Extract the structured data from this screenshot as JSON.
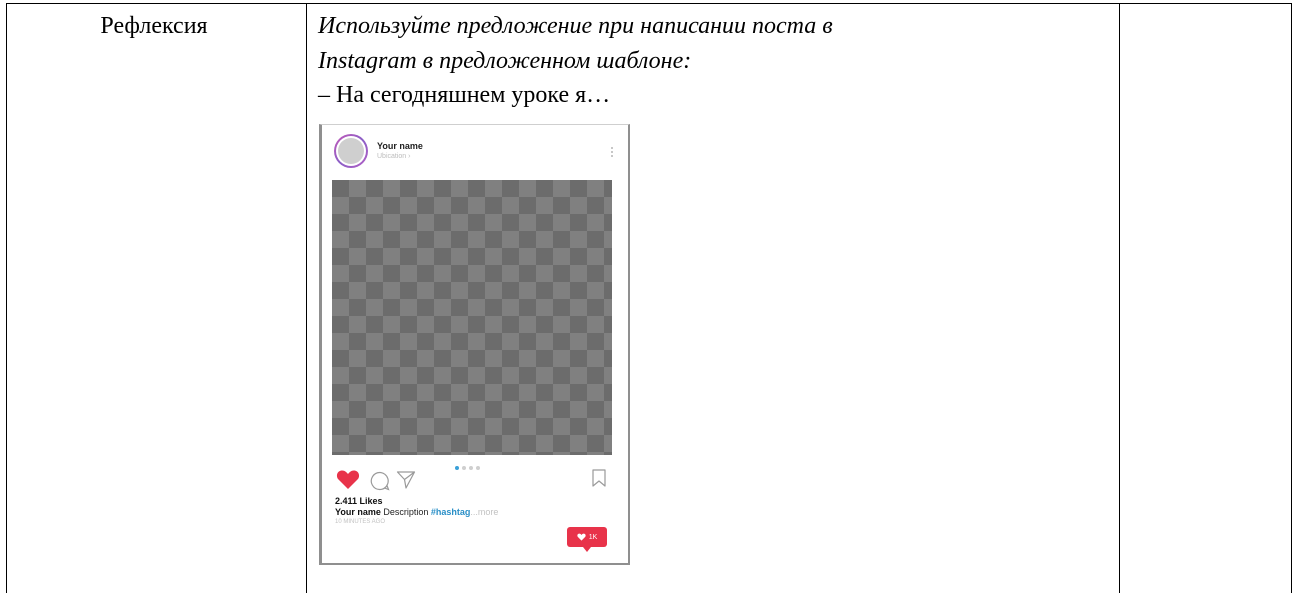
{
  "table": {
    "label_cell": "Рефлексия",
    "instruction_line1": "Используйте предложение при написании поста в",
    "instruction_line2": "Instagram в предложенном шаблоне:",
    "prompt_line": "– На сегодняшнем уроке я…"
  },
  "template": {
    "username": "Your name",
    "location": "Ubication ›",
    "carousel_dots": 4,
    "active_dot": 1,
    "likes": "2.411 Likes",
    "caption_user": "Your name",
    "caption_text": " Description ",
    "caption_hashtag": "#hashtag",
    "caption_more": "...more",
    "timestamp": "10 MINUTES AGO",
    "notification_count": "1K",
    "icons": [
      "heart-icon",
      "comment-icon",
      "share-icon",
      "bookmark-icon",
      "more-options-icon"
    ],
    "colors": {
      "heart": "#e8334a",
      "hashtag": "#2a8fc7",
      "notification": "#e8334a",
      "active_dot": "#3aa0d8"
    }
  }
}
